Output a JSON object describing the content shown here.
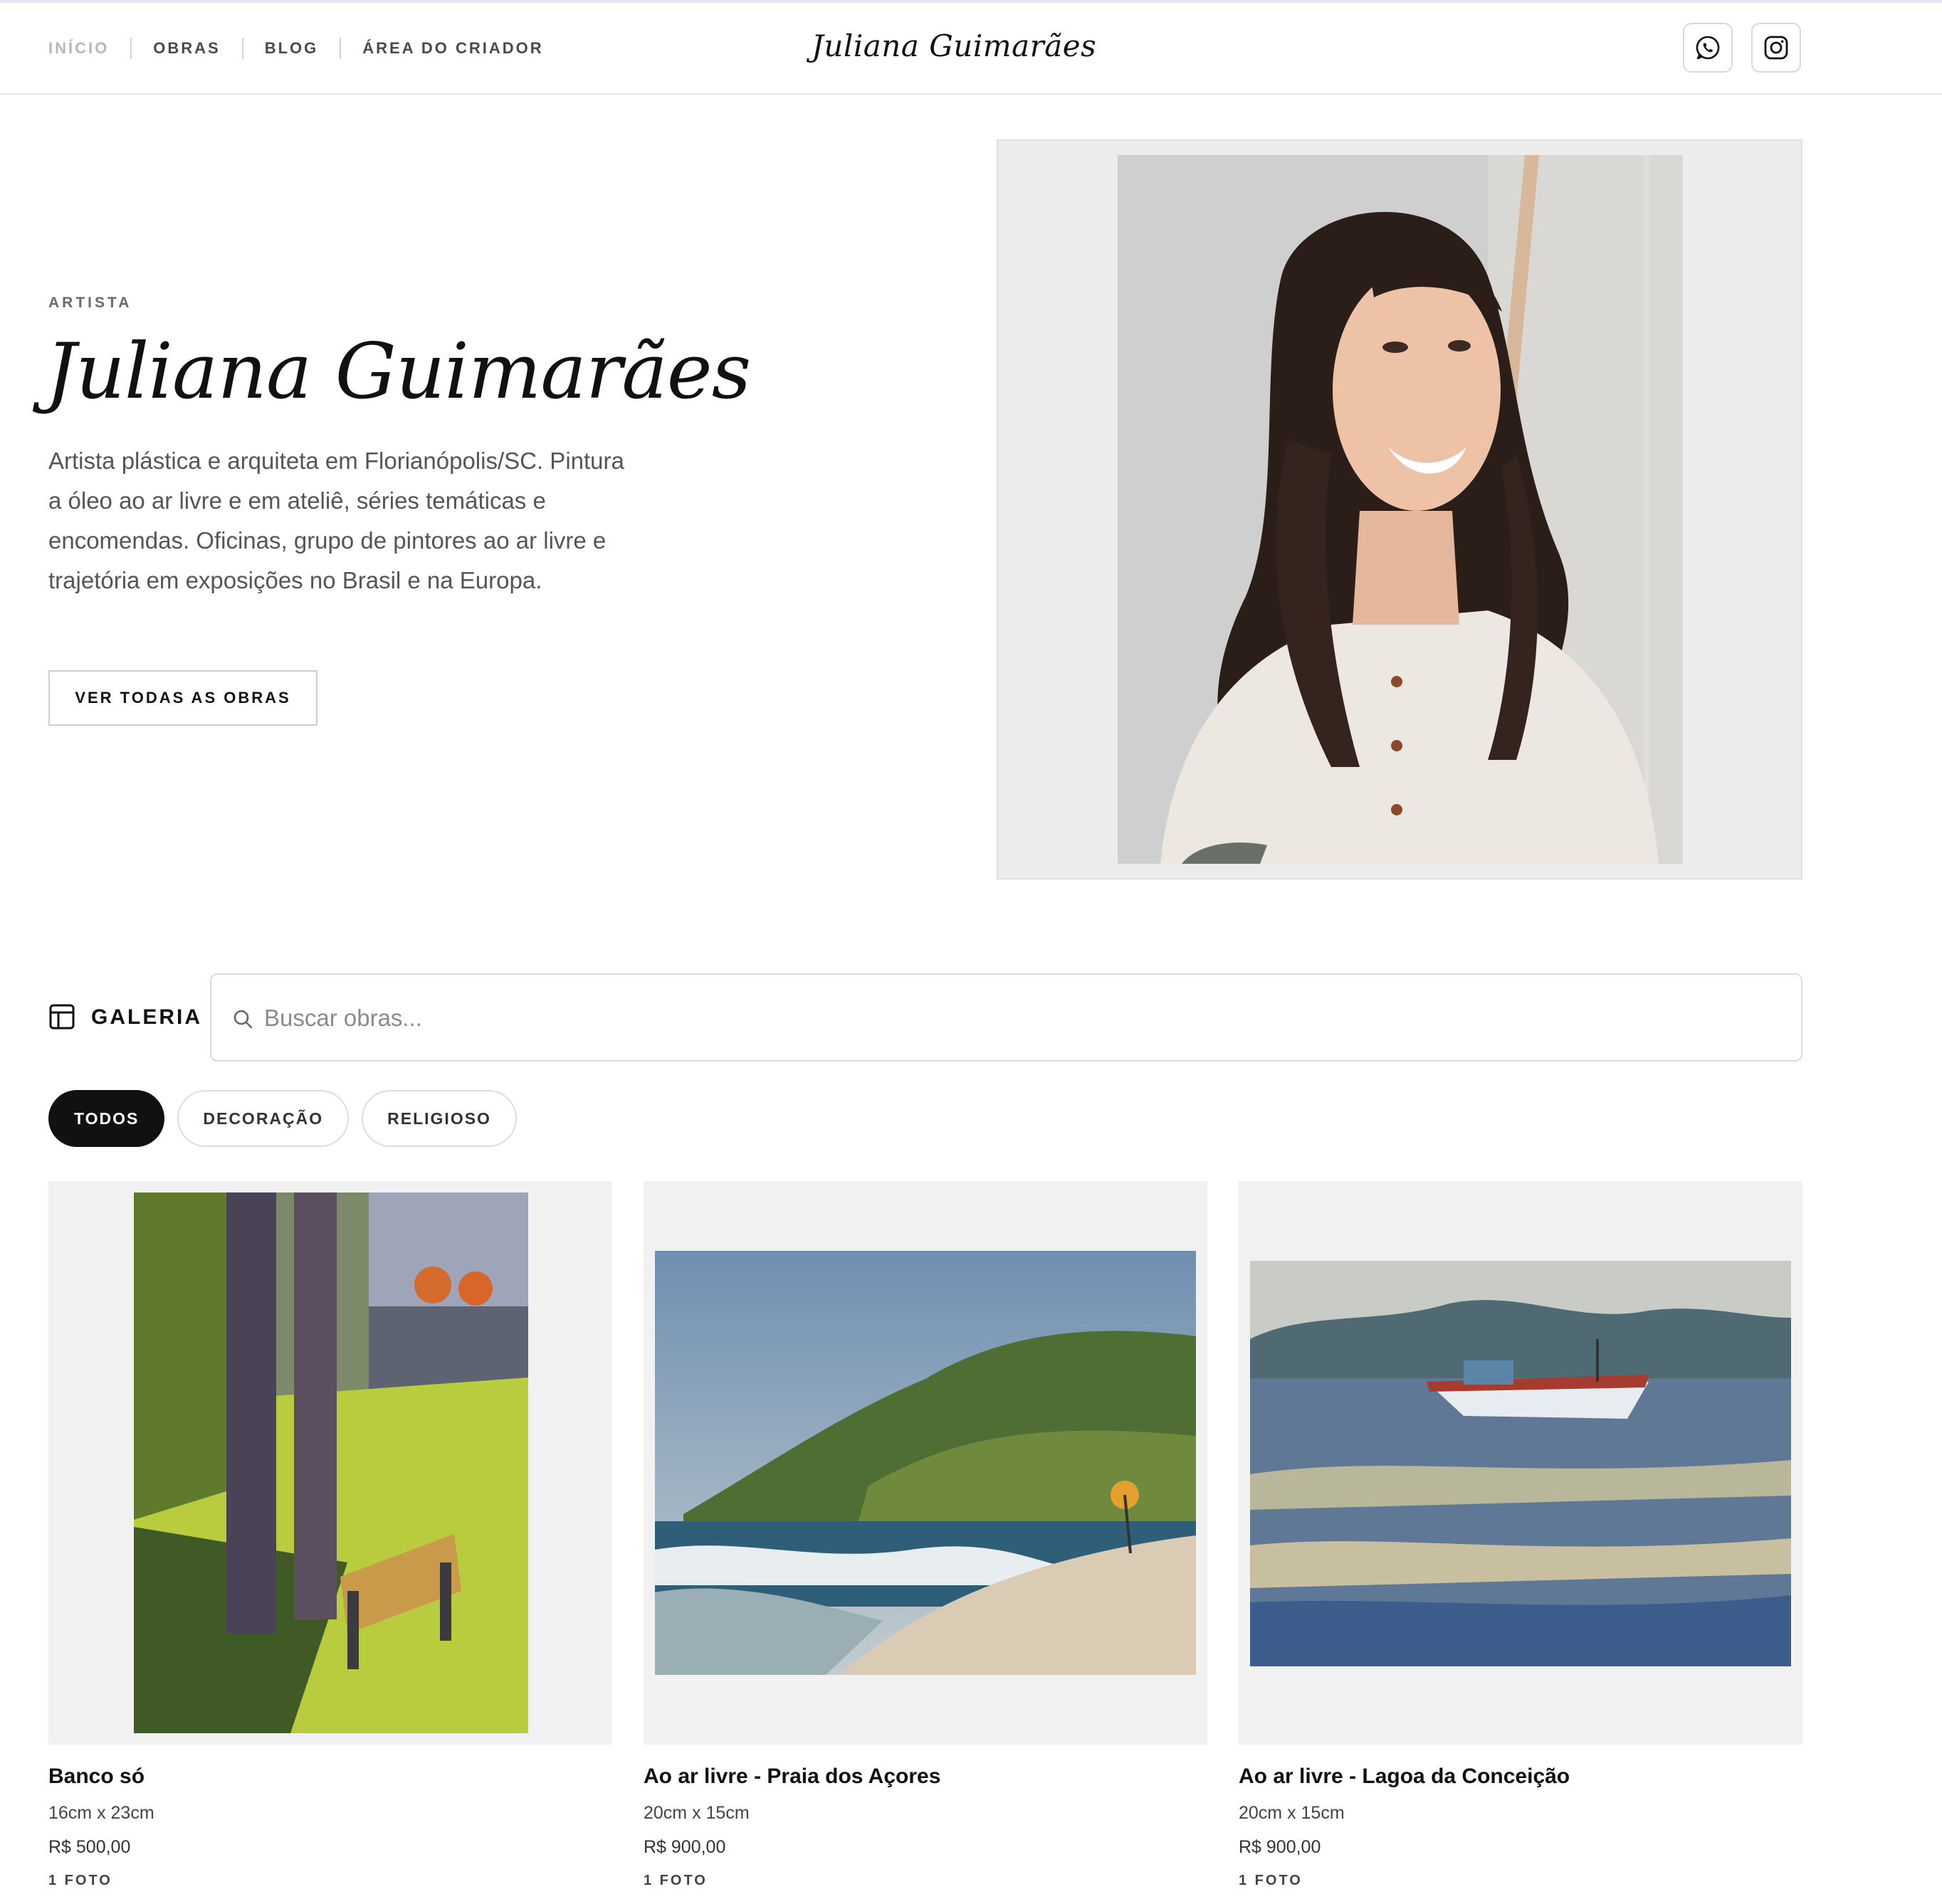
{
  "nav": {
    "items": [
      {
        "label": "INÍCIO"
      },
      {
        "label": "OBRAS"
      },
      {
        "label": "BLOG"
      },
      {
        "label": "ÁREA DO CRIADOR"
      }
    ],
    "logo": "Juliana Guimarães",
    "social": [
      "whatsapp-icon",
      "instagram-icon"
    ]
  },
  "hero": {
    "eyebrow": "ARTISTA",
    "name": "Juliana Guimarães",
    "description": "Artista plástica e arquiteta em Florianópolis/SC. Pintura a óleo ao ar livre e em ateliê, séries temáticas e encomendas. Oficinas, grupo de pintores ao ar livre e trajetória em exposições no Brasil e na Europa.",
    "cta": "VER TODAS AS OBRAS"
  },
  "gallery": {
    "title": "GALERIA",
    "search_placeholder": "Buscar obras...",
    "filters": [
      {
        "label": "TODOS",
        "active": true
      },
      {
        "label": "DECORAÇÃO",
        "active": false
      },
      {
        "label": "RELIGIOSO",
        "active": false
      }
    ],
    "cards": [
      {
        "title": "Banco só",
        "dims": "16cm x 23cm",
        "price": "R$ 500,00",
        "photos": "1 FOTO"
      },
      {
        "title": "Ao ar livre - Praia dos Açores",
        "dims": "20cm x 15cm",
        "price": "R$ 900,00",
        "photos": "1 FOTO"
      },
      {
        "title": "Ao ar livre - Lagoa da Conceição",
        "dims": "20cm x 15cm",
        "price": "R$ 900,00",
        "photos": "1 FOTO"
      }
    ]
  },
  "colors": {
    "accent": "#111111",
    "muted": "#b8b8b8",
    "thumb_bg": "#f1f1f1"
  }
}
